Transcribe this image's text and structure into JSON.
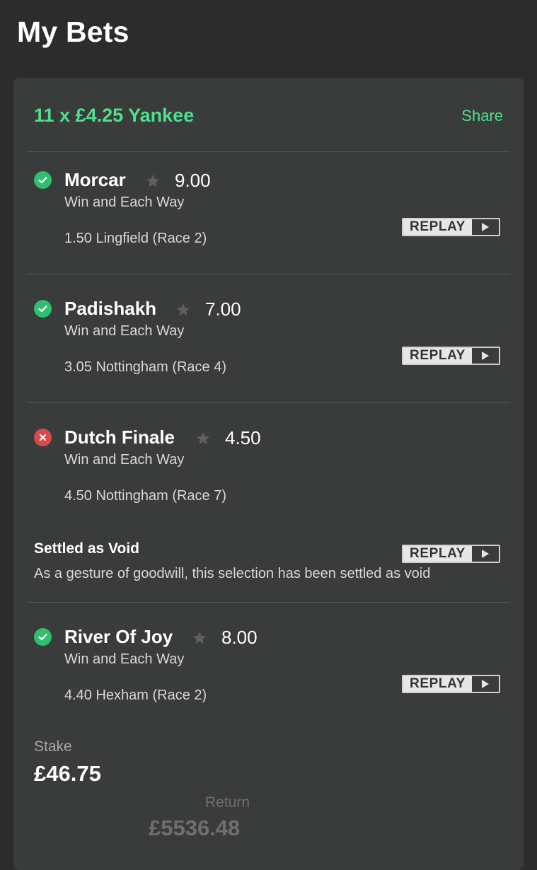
{
  "header": {
    "title": "My Bets"
  },
  "bet": {
    "title": "11 x £4.25 Yankee",
    "share_label": "Share",
    "replay_label": "REPLAY",
    "selections": [
      {
        "status": "won",
        "name": "Morcar",
        "odds": "9.00",
        "market": "Win and Each Way",
        "race": "1.50 Lingfield (Race 2)"
      },
      {
        "status": "won",
        "name": "Padishakh",
        "odds": "7.00",
        "market": "Win and Each Way",
        "race": "3.05 Nottingham (Race 4)"
      },
      {
        "status": "lost",
        "name": "Dutch Finale",
        "odds": "4.50",
        "market": "Win and Each Way",
        "race": "4.50 Nottingham (Race 7)",
        "note_title": "Settled as Void",
        "note_text": "As a gesture of goodwill, this selection has been settled as void"
      },
      {
        "status": "won",
        "name": "River Of Joy",
        "odds": "8.00",
        "market": "Win and Each Way",
        "race": "4.40 Hexham (Race 2)"
      }
    ],
    "stake_label": "Stake",
    "stake_value": "£46.75",
    "return_label": "Return",
    "return_value": "£5536.48"
  },
  "colors": {
    "accent": "#4ee08e",
    "won": "#2fbf6f",
    "lost": "#d94a4a",
    "background": "#2c2c2c",
    "card": "#3a3b3b"
  },
  "icons": {
    "won": "check-circle-icon",
    "lost": "x-circle-icon",
    "favourite": "star-icon",
    "play": "play-icon"
  }
}
